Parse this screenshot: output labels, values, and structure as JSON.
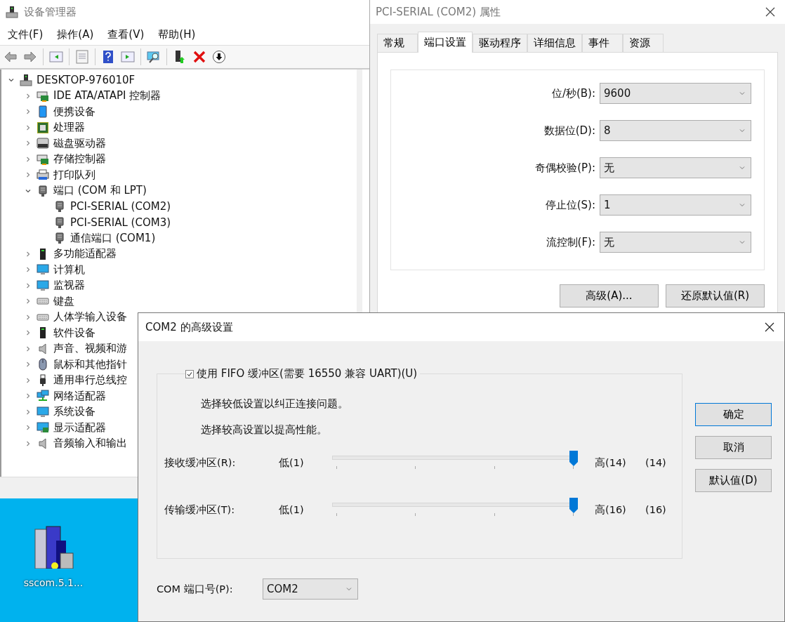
{
  "device_manager": {
    "title": "设备管理器",
    "menu": [
      "文件(F)",
      "操作(A)",
      "查看(V)",
      "帮助(H)"
    ],
    "tree": {
      "label": "DESKTOP-976010F",
      "expanded": true,
      "children": [
        {
          "label": "IDE ATA/ATAPI 控制器",
          "expanded": false
        },
        {
          "label": "便携设备",
          "expanded": false
        },
        {
          "label": "处理器",
          "expanded": false
        },
        {
          "label": "磁盘驱动器",
          "expanded": false
        },
        {
          "label": "存储控制器",
          "expanded": false
        },
        {
          "label": "打印队列",
          "expanded": false
        },
        {
          "label": "端口 (COM 和 LPT)",
          "expanded": true,
          "children": [
            {
              "label": "PCI-SERIAL (COM2)"
            },
            {
              "label": "PCI-SERIAL (COM3)"
            },
            {
              "label": "通信端口 (COM1)"
            }
          ]
        },
        {
          "label": "多功能适配器",
          "expanded": false
        },
        {
          "label": "计算机",
          "expanded": false
        },
        {
          "label": "监视器",
          "expanded": false
        },
        {
          "label": "键盘",
          "expanded": false
        },
        {
          "label": "人体学输入设备",
          "expanded": false
        },
        {
          "label": "软件设备",
          "expanded": false
        },
        {
          "label": "声音、视频和游",
          "expanded": false
        },
        {
          "label": "鼠标和其他指针",
          "expanded": false
        },
        {
          "label": "通用串行总线控",
          "expanded": false
        },
        {
          "label": "网络适配器",
          "expanded": false
        },
        {
          "label": "系统设备",
          "expanded": false
        },
        {
          "label": "显示适配器",
          "expanded": false
        },
        {
          "label": "音频输入和输出",
          "expanded": false
        }
      ]
    }
  },
  "properties": {
    "title": "PCI-SERIAL (COM2) 属性",
    "tabs": [
      {
        "label": "常规",
        "selected": false
      },
      {
        "label": "端口设置",
        "selected": true
      },
      {
        "label": "驱动程序",
        "selected": false
      },
      {
        "label": "详细信息",
        "selected": false
      },
      {
        "label": "事件",
        "selected": false
      },
      {
        "label": "资源",
        "selected": false
      }
    ],
    "fields": [
      {
        "label": "位/秒(B):",
        "value": "9600"
      },
      {
        "label": "数据位(D):",
        "value": "8"
      },
      {
        "label": "奇偶校验(P):",
        "value": "无"
      },
      {
        "label": "停止位(S):",
        "value": "1"
      },
      {
        "label": "流控制(F):",
        "value": "无"
      }
    ],
    "buttons": [
      "高级(A)...",
      "还原默认值(R)"
    ]
  },
  "advanced": {
    "title": "COM2 的高级设置",
    "fifo": {
      "label": "使用 FIFO 缓冲区(需要 16550 兼容 UART)(U)",
      "checked": true
    },
    "hints": [
      "选择较低设置以纠正连接问题。",
      "选择较高设置以提高性能。"
    ],
    "sliders": [
      {
        "label": "接收缓冲区(R):",
        "low": "低(1)",
        "high": "高(14)",
        "reading": "(14)",
        "level": 1
      },
      {
        "label": "传输缓冲区(T):",
        "low": "低(1)",
        "high": "高(16)",
        "reading": "(16)",
        "level": 1
      }
    ],
    "port": {
      "label": "COM 端口号(P):",
      "value": "COM2"
    },
    "buttons": [
      {
        "label": "确定",
        "default": true
      },
      {
        "label": "取消",
        "default": false
      },
      {
        "label": "默认值(D)",
        "default": false
      }
    ]
  },
  "desktop": {
    "icons": [
      {
        "label": "sscom.5.1..."
      }
    ]
  }
}
